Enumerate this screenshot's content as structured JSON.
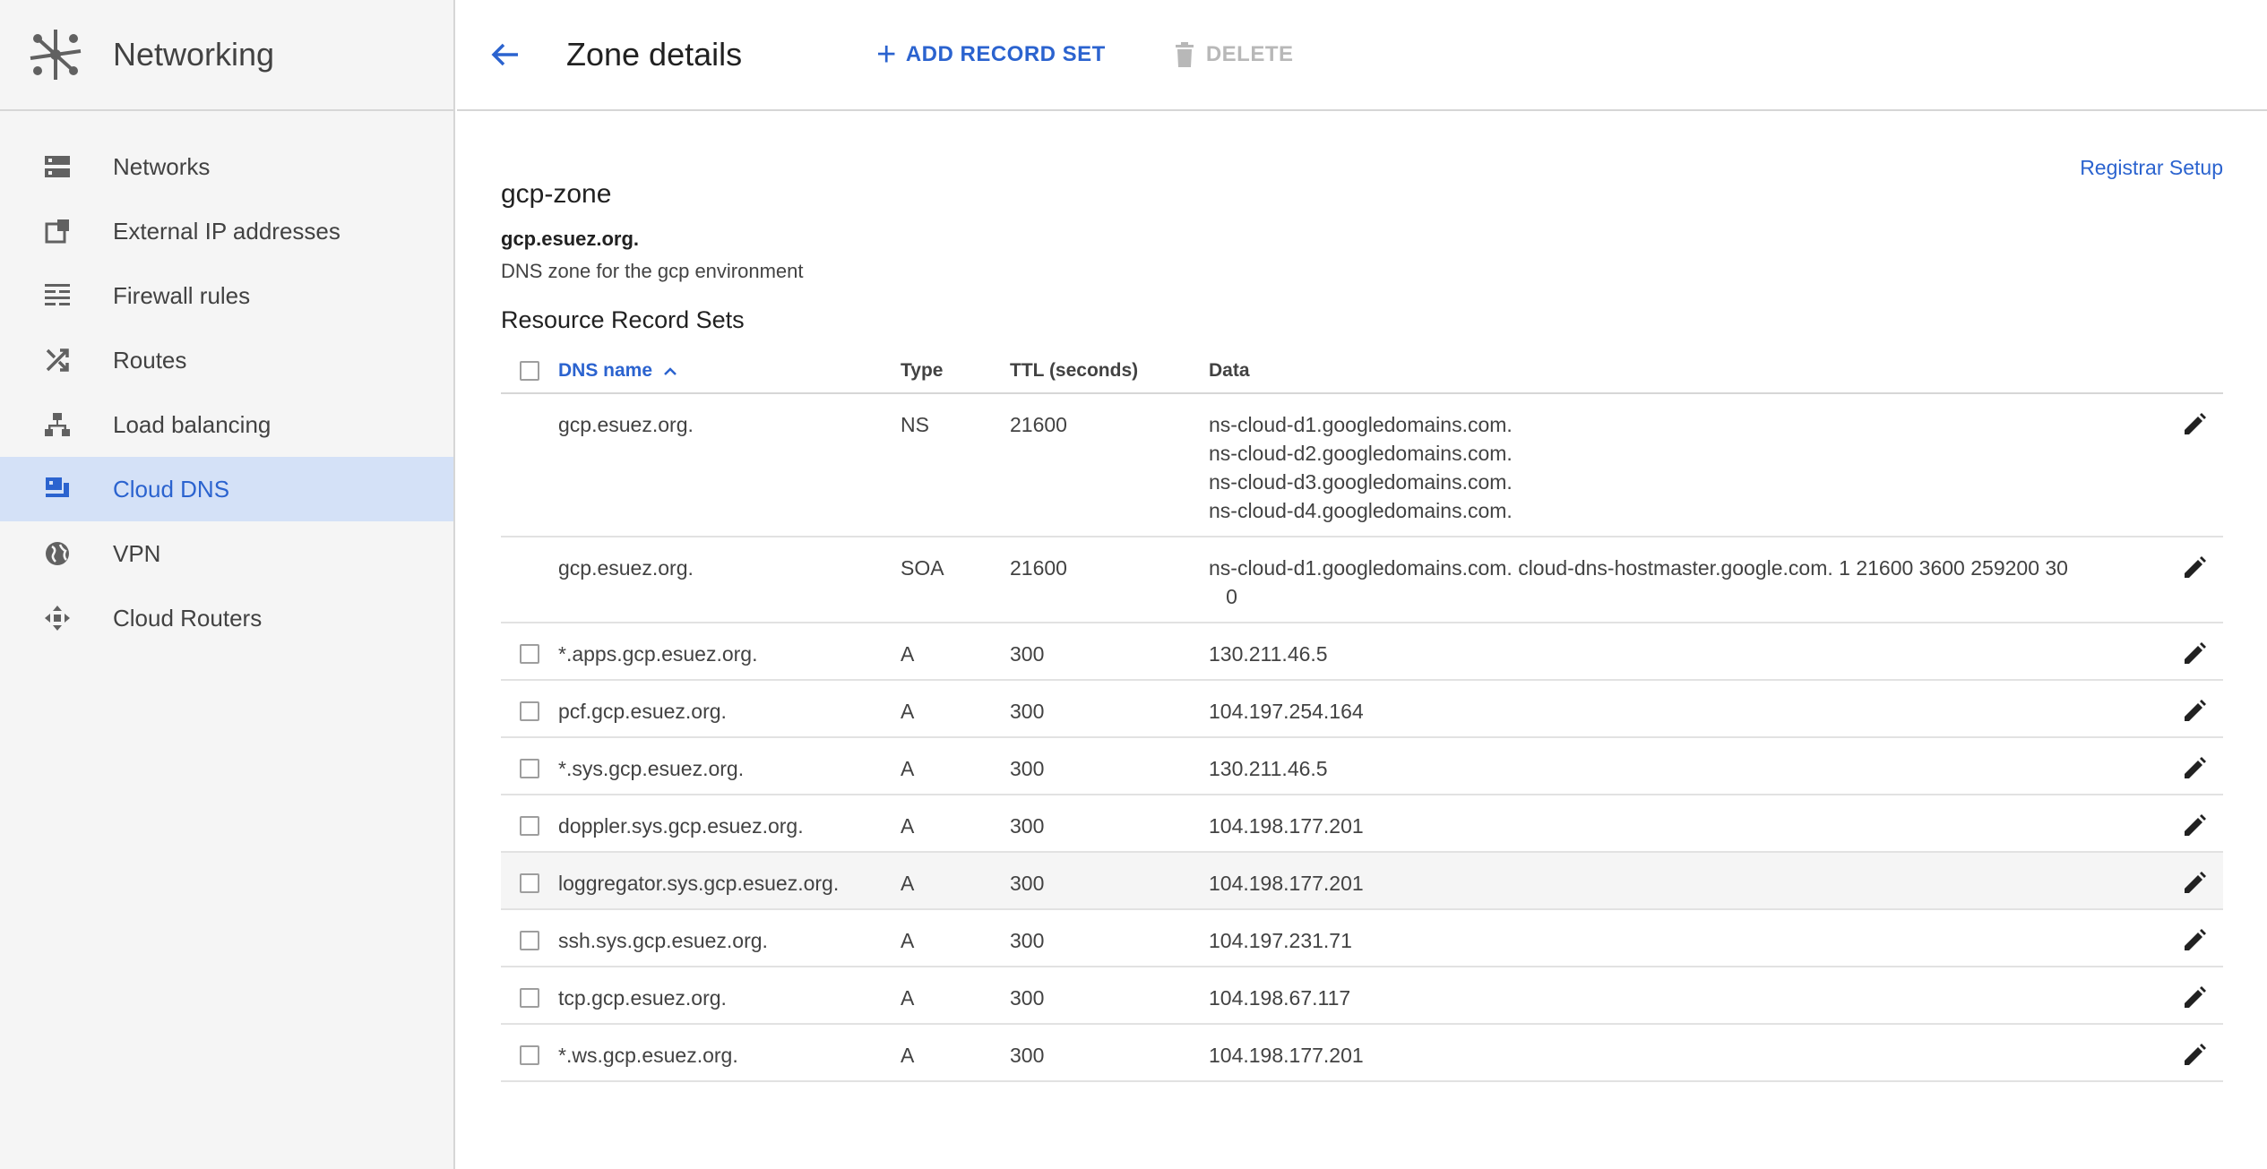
{
  "sidebar": {
    "title": "Networking",
    "items": [
      {
        "label": "Networks",
        "icon": "networks-icon",
        "active": false
      },
      {
        "label": "External IP addresses",
        "icon": "external-ip-icon",
        "active": false
      },
      {
        "label": "Firewall rules",
        "icon": "firewall-icon",
        "active": false
      },
      {
        "label": "Routes",
        "icon": "routes-icon",
        "active": false
      },
      {
        "label": "Load balancing",
        "icon": "load-balancing-icon",
        "active": false
      },
      {
        "label": "Cloud DNS",
        "icon": "cloud-dns-icon",
        "active": true
      },
      {
        "label": "VPN",
        "icon": "vpn-icon",
        "active": false
      },
      {
        "label": "Cloud Routers",
        "icon": "cloud-routers-icon",
        "active": false
      }
    ]
  },
  "header": {
    "title": "Zone details",
    "add_label": "ADD RECORD SET",
    "delete_label": "DELETE"
  },
  "zone": {
    "registrar_link": "Registrar Setup",
    "name": "gcp-zone",
    "dns_name": "gcp.esuez.org.",
    "description": "DNS zone for the gcp environment"
  },
  "records": {
    "title": "Resource Record Sets",
    "columns": {
      "name": "DNS name",
      "type": "Type",
      "ttl": "TTL (seconds)",
      "data": "Data"
    },
    "rows": [
      {
        "name": "gcp.esuez.org.",
        "type": "NS",
        "ttl": "21600",
        "selectable": false,
        "data": [
          "ns-cloud-d1.googledomains.com.",
          "ns-cloud-d2.googledomains.com.",
          "ns-cloud-d3.googledomains.com.",
          "ns-cloud-d4.googledomains.com."
        ]
      },
      {
        "name": "gcp.esuez.org.",
        "type": "SOA",
        "ttl": "21600",
        "selectable": false,
        "data": [
          "ns-cloud-d1.googledomains.com. cloud-dns-hostmaster.google.com. 1 21600 3600 259200 30",
          "   0"
        ]
      },
      {
        "name": "*.apps.gcp.esuez.org.",
        "type": "A",
        "ttl": "300",
        "selectable": true,
        "data": [
          "130.211.46.5"
        ]
      },
      {
        "name": "pcf.gcp.esuez.org.",
        "type": "A",
        "ttl": "300",
        "selectable": true,
        "data": [
          "104.197.254.164"
        ]
      },
      {
        "name": "*.sys.gcp.esuez.org.",
        "type": "A",
        "ttl": "300",
        "selectable": true,
        "data": [
          "130.211.46.5"
        ]
      },
      {
        "name": "doppler.sys.gcp.esuez.org.",
        "type": "A",
        "ttl": "300",
        "selectable": true,
        "data": [
          "104.198.177.201"
        ]
      },
      {
        "name": "loggregator.sys.gcp.esuez.org.",
        "type": "A",
        "ttl": "300",
        "selectable": true,
        "hover": true,
        "data": [
          "104.198.177.201"
        ]
      },
      {
        "name": "ssh.sys.gcp.esuez.org.",
        "type": "A",
        "ttl": "300",
        "selectable": true,
        "data": [
          "104.197.231.71"
        ]
      },
      {
        "name": "tcp.gcp.esuez.org.",
        "type": "A",
        "ttl": "300",
        "selectable": true,
        "data": [
          "104.198.67.117"
        ]
      },
      {
        "name": "*.ws.gcp.esuez.org.",
        "type": "A",
        "ttl": "300",
        "selectable": true,
        "data": [
          "104.198.177.201"
        ]
      }
    ]
  },
  "colors": {
    "accent": "#2b63cf",
    "active_bg": "#d4e1f7",
    "sidebar_bg": "#f5f5f5",
    "disabled": "#b8b8b8"
  }
}
